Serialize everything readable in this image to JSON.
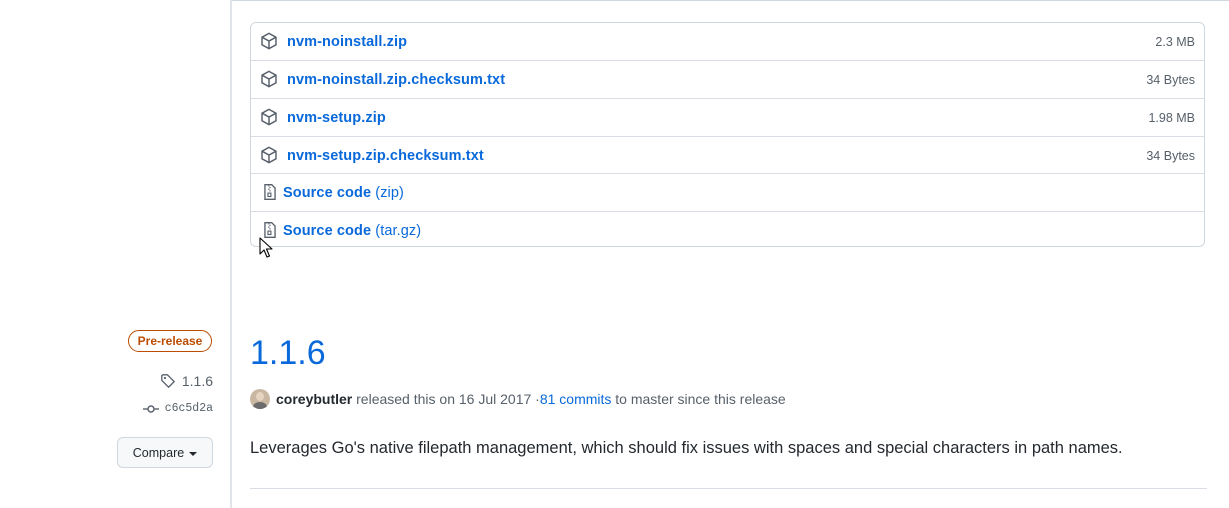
{
  "assets": [
    {
      "name": "nvm-noinstall.zip",
      "size": "2.3 MB",
      "icon": "package-icon"
    },
    {
      "name": "nvm-noinstall.zip.checksum.txt",
      "size": "34 Bytes",
      "icon": "package-icon"
    },
    {
      "name": "nvm-setup.zip",
      "size": "1.98 MB",
      "icon": "package-icon"
    },
    {
      "name": "nvm-setup.zip.checksum.txt",
      "size": "34 Bytes",
      "icon": "package-icon"
    },
    {
      "name": "Source code",
      "suffix": "(zip)",
      "icon": "file-zip-icon"
    },
    {
      "name": "Source code",
      "suffix": "(tar.gz)",
      "icon": "file-zip-icon"
    }
  ],
  "sidebar": {
    "badge": "Pre-release",
    "tag": "1.1.6",
    "commit": "c6c5d2a",
    "compare_label": "Compare"
  },
  "release": {
    "title": "1.1.6",
    "author": "coreybutler",
    "released_text": "released this on 16 Jul 2017 · ",
    "commits_link": "81 commits",
    "commits_suffix": "to master since this release",
    "body": "Leverages Go's native filepath management, which should fix issues with spaces and special characters in path names."
  },
  "colors": {
    "link": "#0969da",
    "prerelease": "#bc4c00",
    "muted": "#57606a"
  }
}
